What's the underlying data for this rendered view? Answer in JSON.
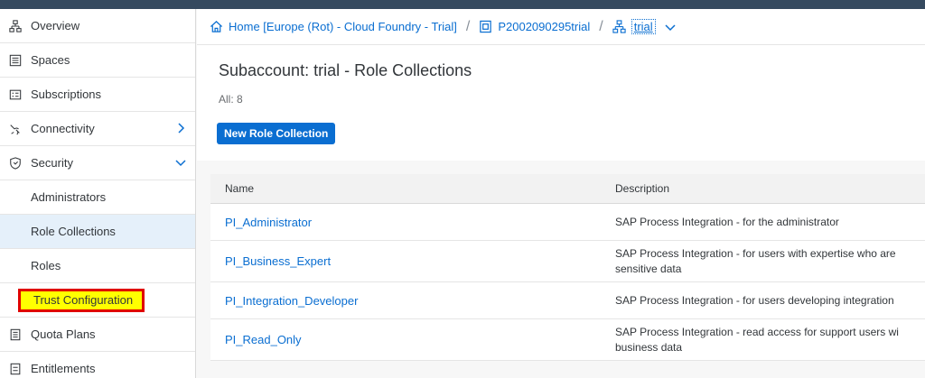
{
  "sidebar": {
    "items": [
      {
        "label": "Overview",
        "icon": "org-chart-icon"
      },
      {
        "label": "Spaces",
        "icon": "spaces-icon"
      },
      {
        "label": "Subscriptions",
        "icon": "subscriptions-icon"
      },
      {
        "label": "Connectivity",
        "icon": "connectivity-icon"
      },
      {
        "label": "Security",
        "icon": "shield-icon"
      },
      {
        "label": "Administrators"
      },
      {
        "label": "Role Collections"
      },
      {
        "label": "Roles"
      },
      {
        "label": "Trust Configuration"
      },
      {
        "label": "Quota Plans",
        "icon": "quota-icon"
      },
      {
        "label": "Entitlements",
        "icon": "entitlements-icon"
      }
    ]
  },
  "breadcrumb": {
    "home": "Home [Europe (Rot) - Cloud Foundry - Trial]",
    "account": "P2002090295trial",
    "subaccount": "trial"
  },
  "header": {
    "title": "Subaccount: trial - Role Collections",
    "count": "All: 8",
    "new_button": "New Role Collection"
  },
  "table": {
    "columns": [
      "Name",
      "Description"
    ],
    "rows": [
      {
        "name": "PI_Administrator",
        "desc1": "SAP Process Integration - for the administrator",
        "desc2": ""
      },
      {
        "name": "PI_Business_Expert",
        "desc1": "SAP Process Integration - for users with expertise who are",
        "desc2": "sensitive data"
      },
      {
        "name": "PI_Integration_Developer",
        "desc1": "SAP Process Integration - for users developing integration",
        "desc2": ""
      },
      {
        "name": "PI_Read_Only",
        "desc1": "SAP Process Integration - read access for support users wi",
        "desc2": "business data"
      }
    ]
  },
  "colors": {
    "accent": "#0a6ed1",
    "highlight": "#ffff00",
    "highlight_border": "#e00000",
    "selected": "#e5f0fa"
  }
}
